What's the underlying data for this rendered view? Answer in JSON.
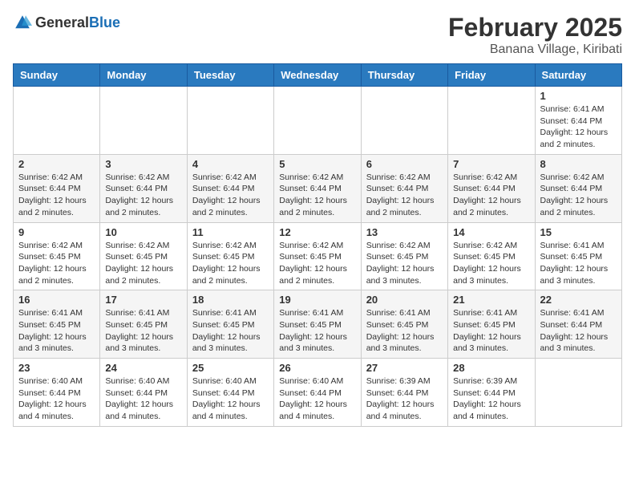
{
  "header": {
    "logo_general": "General",
    "logo_blue": "Blue",
    "title": "February 2025",
    "subtitle": "Banana Village, Kiribati"
  },
  "weekdays": [
    "Sunday",
    "Monday",
    "Tuesday",
    "Wednesday",
    "Thursday",
    "Friday",
    "Saturday"
  ],
  "weeks": [
    [
      {
        "day": "",
        "info": ""
      },
      {
        "day": "",
        "info": ""
      },
      {
        "day": "",
        "info": ""
      },
      {
        "day": "",
        "info": ""
      },
      {
        "day": "",
        "info": ""
      },
      {
        "day": "",
        "info": ""
      },
      {
        "day": "1",
        "info": "Sunrise: 6:41 AM\nSunset: 6:44 PM\nDaylight: 12 hours\nand 2 minutes."
      }
    ],
    [
      {
        "day": "2",
        "info": "Sunrise: 6:42 AM\nSunset: 6:44 PM\nDaylight: 12 hours\nand 2 minutes."
      },
      {
        "day": "3",
        "info": "Sunrise: 6:42 AM\nSunset: 6:44 PM\nDaylight: 12 hours\nand 2 minutes."
      },
      {
        "day": "4",
        "info": "Sunrise: 6:42 AM\nSunset: 6:44 PM\nDaylight: 12 hours\nand 2 minutes."
      },
      {
        "day": "5",
        "info": "Sunrise: 6:42 AM\nSunset: 6:44 PM\nDaylight: 12 hours\nand 2 minutes."
      },
      {
        "day": "6",
        "info": "Sunrise: 6:42 AM\nSunset: 6:44 PM\nDaylight: 12 hours\nand 2 minutes."
      },
      {
        "day": "7",
        "info": "Sunrise: 6:42 AM\nSunset: 6:44 PM\nDaylight: 12 hours\nand 2 minutes."
      },
      {
        "day": "8",
        "info": "Sunrise: 6:42 AM\nSunset: 6:44 PM\nDaylight: 12 hours\nand 2 minutes."
      }
    ],
    [
      {
        "day": "9",
        "info": "Sunrise: 6:42 AM\nSunset: 6:45 PM\nDaylight: 12 hours\nand 2 minutes."
      },
      {
        "day": "10",
        "info": "Sunrise: 6:42 AM\nSunset: 6:45 PM\nDaylight: 12 hours\nand 2 minutes."
      },
      {
        "day": "11",
        "info": "Sunrise: 6:42 AM\nSunset: 6:45 PM\nDaylight: 12 hours\nand 2 minutes."
      },
      {
        "day": "12",
        "info": "Sunrise: 6:42 AM\nSunset: 6:45 PM\nDaylight: 12 hours\nand 2 minutes."
      },
      {
        "day": "13",
        "info": "Sunrise: 6:42 AM\nSunset: 6:45 PM\nDaylight: 12 hours\nand 3 minutes."
      },
      {
        "day": "14",
        "info": "Sunrise: 6:42 AM\nSunset: 6:45 PM\nDaylight: 12 hours\nand 3 minutes."
      },
      {
        "day": "15",
        "info": "Sunrise: 6:41 AM\nSunset: 6:45 PM\nDaylight: 12 hours\nand 3 minutes."
      }
    ],
    [
      {
        "day": "16",
        "info": "Sunrise: 6:41 AM\nSunset: 6:45 PM\nDaylight: 12 hours\nand 3 minutes."
      },
      {
        "day": "17",
        "info": "Sunrise: 6:41 AM\nSunset: 6:45 PM\nDaylight: 12 hours\nand 3 minutes."
      },
      {
        "day": "18",
        "info": "Sunrise: 6:41 AM\nSunset: 6:45 PM\nDaylight: 12 hours\nand 3 minutes."
      },
      {
        "day": "19",
        "info": "Sunrise: 6:41 AM\nSunset: 6:45 PM\nDaylight: 12 hours\nand 3 minutes."
      },
      {
        "day": "20",
        "info": "Sunrise: 6:41 AM\nSunset: 6:45 PM\nDaylight: 12 hours\nand 3 minutes."
      },
      {
        "day": "21",
        "info": "Sunrise: 6:41 AM\nSunset: 6:45 PM\nDaylight: 12 hours\nand 3 minutes."
      },
      {
        "day": "22",
        "info": "Sunrise: 6:41 AM\nSunset: 6:44 PM\nDaylight: 12 hours\nand 3 minutes."
      }
    ],
    [
      {
        "day": "23",
        "info": "Sunrise: 6:40 AM\nSunset: 6:44 PM\nDaylight: 12 hours\nand 4 minutes."
      },
      {
        "day": "24",
        "info": "Sunrise: 6:40 AM\nSunset: 6:44 PM\nDaylight: 12 hours\nand 4 minutes."
      },
      {
        "day": "25",
        "info": "Sunrise: 6:40 AM\nSunset: 6:44 PM\nDaylight: 12 hours\nand 4 minutes."
      },
      {
        "day": "26",
        "info": "Sunrise: 6:40 AM\nSunset: 6:44 PM\nDaylight: 12 hours\nand 4 minutes."
      },
      {
        "day": "27",
        "info": "Sunrise: 6:39 AM\nSunset: 6:44 PM\nDaylight: 12 hours\nand 4 minutes."
      },
      {
        "day": "28",
        "info": "Sunrise: 6:39 AM\nSunset: 6:44 PM\nDaylight: 12 hours\nand 4 minutes."
      },
      {
        "day": "",
        "info": ""
      }
    ]
  ]
}
